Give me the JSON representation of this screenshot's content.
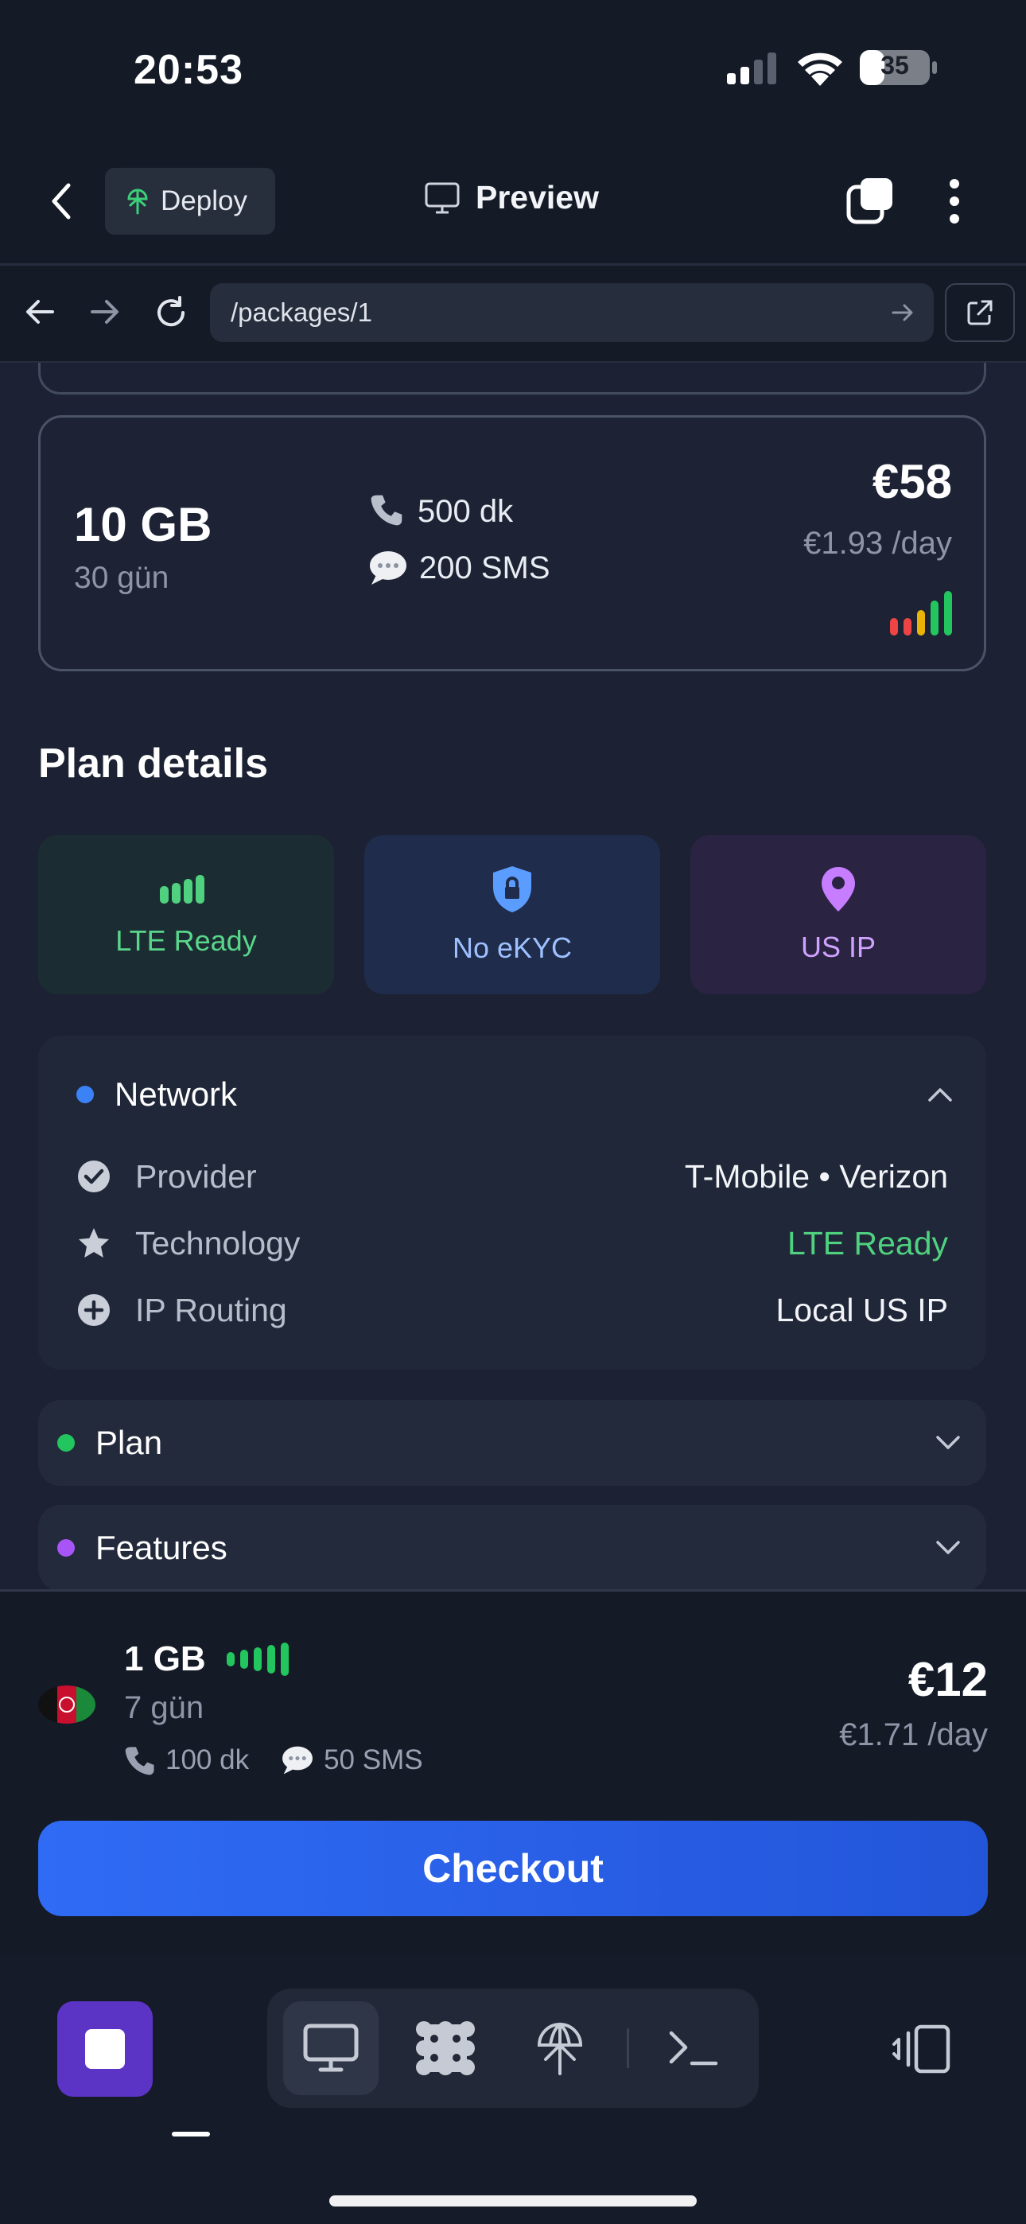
{
  "status": {
    "time": "20:53",
    "battery": "35"
  },
  "header": {
    "deploy_label": "Deploy",
    "preview_label": "Preview"
  },
  "urlbar": {
    "url": "/packages/1"
  },
  "package": {
    "data": "10 GB",
    "duration": "30 gün",
    "minutes": "500 dk",
    "sms": "200 SMS",
    "price": "€58",
    "per_day": "€1.93 /day",
    "signal_strength_of_5": 5
  },
  "plan_details": {
    "title": "Plan details",
    "tiles": [
      {
        "label": "LTE Ready",
        "icon": "signal-bars-icon"
      },
      {
        "label": "No eKYC",
        "icon": "shield-lock-icon"
      },
      {
        "label": "US IP",
        "icon": "location-pin-icon"
      }
    ],
    "network": {
      "title": "Network",
      "rows": [
        {
          "label": "Provider",
          "value": "T-Mobile • Verizon",
          "icon": "check-circle-icon"
        },
        {
          "label": "Technology",
          "value": "LTE Ready",
          "icon": "star-icon"
        },
        {
          "label": "IP Routing",
          "value": "Local US IP",
          "icon": "plus-circle-icon"
        }
      ]
    },
    "plan_section": {
      "title": "Plan"
    },
    "features_section": {
      "title": "Features"
    }
  },
  "purchase": {
    "data": "1 GB",
    "duration": "7 gün",
    "minutes": "100 dk",
    "sms": "50 SMS",
    "price": "€12",
    "per_day": "€1.71 /day",
    "checkout_label": "Checkout"
  },
  "colors": {
    "accent_blue": "#2f6bf5",
    "lte_green": "#4fd17f",
    "network_dot": "#3b82f6",
    "plan_dot": "#22c55e",
    "features_dot": "#a855f7"
  }
}
